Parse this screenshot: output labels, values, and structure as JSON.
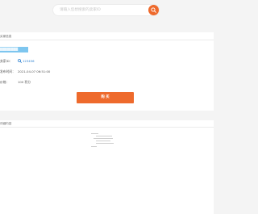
{
  "search": {
    "placeholder": "请输入您想搜索的卖家ID",
    "button_icon": "search-icon"
  },
  "info": {
    "section_title": "买家信息",
    "product_name": "████████",
    "seller_label": "卖家ID：",
    "seller_value": "123456",
    "seller_icon": "search-icon",
    "time_label": "发布时间：",
    "time_value": "2021-04-07 06:51:00",
    "price_label": "价格：",
    "price_value": "100 积分",
    "buy_label": "购 买"
  },
  "content": {
    "section_title": "详细内容"
  },
  "colors": {
    "accent": "#ee6a2c",
    "link": "#2a7fd0",
    "product_highlight": "#7ec6ef",
    "background": "#f4f4f4"
  }
}
